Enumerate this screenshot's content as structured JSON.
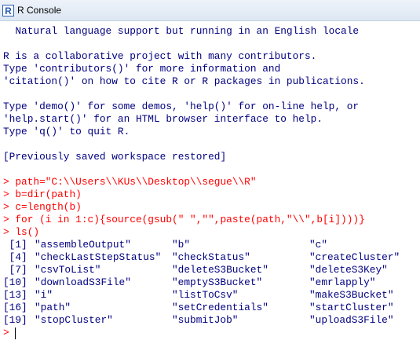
{
  "window": {
    "title": "R Console",
    "logo_letter": "R"
  },
  "console": {
    "startup_lines": [
      "  Natural language support but running in an English locale",
      "",
      "R is a collaborative project with many contributors.",
      "Type 'contributors()' for more information and",
      "'citation()' on how to cite R or R packages in publications.",
      "",
      "Type 'demo()' for some demos, 'help()' for on-line help, or",
      "'help.start()' for an HTML browser interface to help.",
      "Type 'q()' to quit R.",
      "",
      "[Previously saved workspace restored]",
      ""
    ],
    "commands": [
      "> path=\"C:\\\\Users\\\\KUs\\\\Desktop\\\\segue\\\\R\"",
      "> b=dir(path)",
      "> c=length(b)",
      "> for (i in 1:c){source(gsub(\" \",\"\",paste(path,\"\\\\\",b[i])))}",
      "> ls()"
    ],
    "ls_output": [
      {
        "index": " [1]",
        "items": [
          "\"assembleOutput\"",
          "\"b\"",
          "\"c\""
        ]
      },
      {
        "index": " [4]",
        "items": [
          "\"checkLastStepStatus\"",
          "\"checkStatus\"",
          "\"createCluster\""
        ]
      },
      {
        "index": " [7]",
        "items": [
          "\"csvToList\"",
          "\"deleteS3Bucket\"",
          "\"deleteS3Key\""
        ]
      },
      {
        "index": "[10]",
        "items": [
          "\"downloadS3File\"",
          "\"emptyS3Bucket\"",
          "\"emrlapply\""
        ]
      },
      {
        "index": "[13]",
        "items": [
          "\"i\"",
          "\"listToCsv\"",
          "\"makeS3Bucket\""
        ]
      },
      {
        "index": "[16]",
        "items": [
          "\"path\"",
          "\"setCredentials\"",
          "\"startCluster\""
        ]
      },
      {
        "index": "[19]",
        "items": [
          "\"stopCluster\"",
          "\"submitJob\"",
          "\"uploadS3File\""
        ]
      }
    ],
    "prompt": "> ",
    "colors": {
      "output": "#000080",
      "input": "#ff0000",
      "logo": "#2a5db0"
    }
  }
}
